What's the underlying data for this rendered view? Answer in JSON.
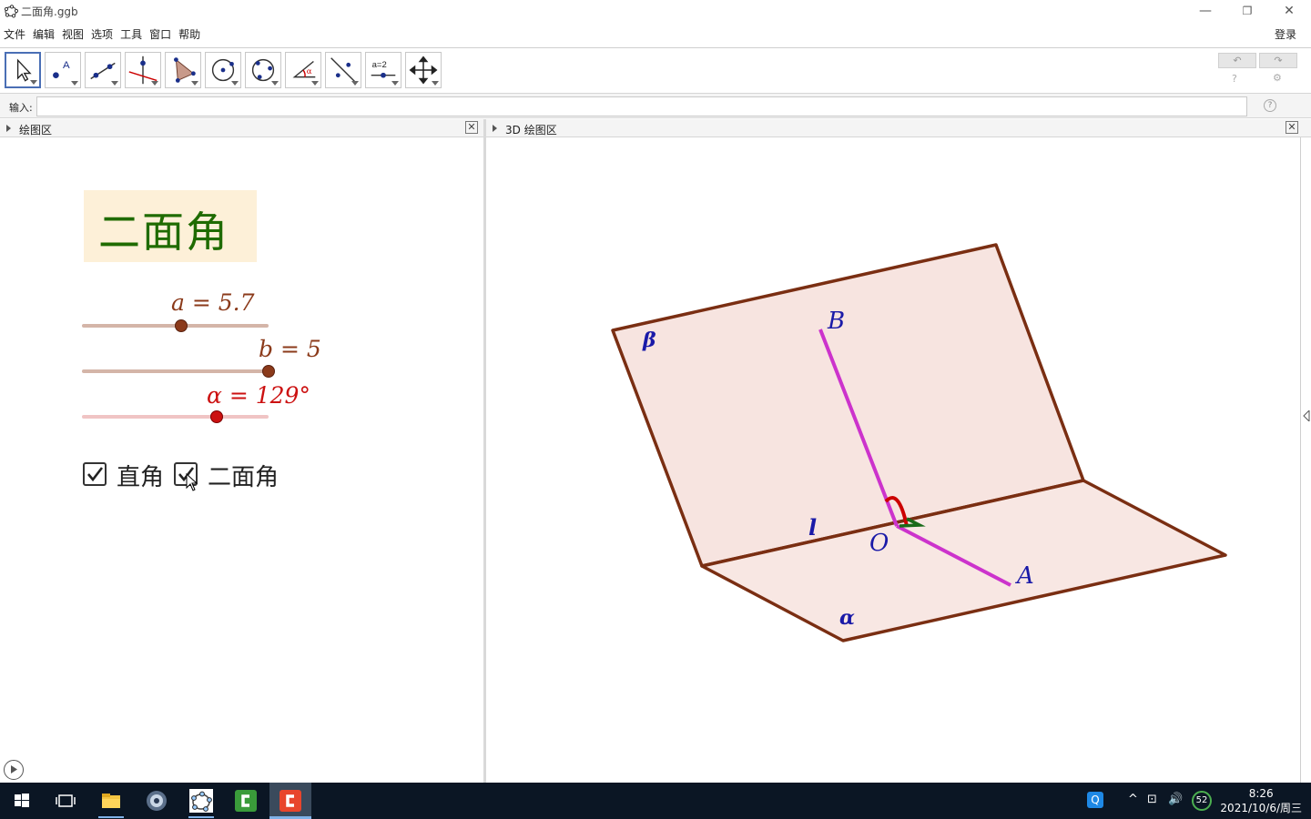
{
  "window": {
    "title": "二面角.ggb"
  },
  "menu": {
    "items": [
      "文件",
      "编辑",
      "视图",
      "选项",
      "工具",
      "窗口",
      "帮助"
    ],
    "login": "登录"
  },
  "toolbar": {
    "tools": [
      "move-tool",
      "point-tool",
      "line-tool",
      "perpendicular-tool",
      "polygon-tool",
      "circle-tool",
      "circle-three-points-tool",
      "angle-tool",
      "reflect-tool",
      "slider-tool",
      "move-view-tool"
    ],
    "slider_tool_text": "a=2",
    "undo": "↶",
    "redo": "↷",
    "help": "?",
    "settings": "⚙"
  },
  "input_bar": {
    "label": "输入:",
    "value": "",
    "help": "?"
  },
  "panels": {
    "graphics": {
      "title": "绘图区",
      "close": "✕"
    },
    "graphics3d": {
      "title": "3D 绘图区",
      "close": "✕"
    }
  },
  "graphics": {
    "heading": "二面角",
    "sliders": [
      {
        "label": "a = 5.7",
        "fraction": 0.53,
        "color": "#8b3a1a",
        "track": "#d4b5a8"
      },
      {
        "label": "b = 5",
        "fraction": 1.0,
        "color": "#8b3a1a",
        "track": "#d4b5a8"
      },
      {
        "label": "α = 129°",
        "fraction": 0.72,
        "color": "#cc1111",
        "track": "#f0c4c4"
      }
    ],
    "checkboxes": [
      {
        "label": "直角",
        "checked": true
      },
      {
        "label": "二面角",
        "checked": true
      }
    ],
    "play": "▶"
  },
  "scene3d": {
    "labels": {
      "beta": "β",
      "alpha": "α",
      "B": "B",
      "A": "A",
      "O": "O",
      "l": "l"
    },
    "colors": {
      "edge": "#7a2e12",
      "fill": "#f7e4e0",
      "segment": "#cc33cc",
      "label": "#1a1aa8",
      "angle": "#cc0000",
      "right_angle": "#1a6b1a"
    }
  },
  "taskbar": {
    "apps": [
      "windows-start",
      "task-view",
      "file-explorer",
      "browser",
      "geogebra",
      "camtasia",
      "camtasia-recorder"
    ],
    "tray": {
      "qq": "Q",
      "chevron": "^",
      "network": "⊡",
      "volume": "🔊",
      "badge": "52"
    },
    "time": "8:26",
    "date": "2021/10/6/周三"
  }
}
